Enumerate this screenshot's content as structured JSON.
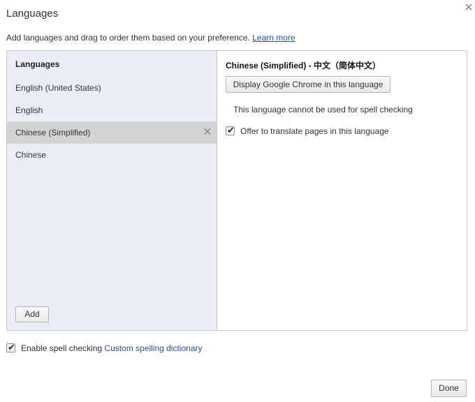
{
  "dialog": {
    "title": "Languages",
    "description": "Add languages and drag to order them based on your preference.",
    "learn_more": "Learn more"
  },
  "left": {
    "header": "Languages",
    "items": [
      {
        "label": "English (United States)",
        "selected": false
      },
      {
        "label": "English",
        "selected": false
      },
      {
        "label": "Chinese (Simplified)",
        "selected": true
      },
      {
        "label": "Chinese",
        "selected": false
      }
    ],
    "add_label": "Add"
  },
  "right": {
    "title": "Chinese (Simplified) - 中文（简体中文）",
    "display_button": "Display Google Chrome in this language",
    "spell_note": "This language cannot be used for spell checking",
    "translate_label": "Offer to translate pages in this language",
    "translate_checked": true
  },
  "footer": {
    "spell_label": "Enable spell checking",
    "spell_checked": true,
    "custom_dictionary": "Custom spelling dictionary",
    "done_label": "Done"
  },
  "colors": {
    "left_bg": "#ebeef9",
    "selected_bg": "#d4d4d4",
    "link": "#1c4fb6"
  },
  "icons": {
    "close": "close-icon",
    "remove": "remove-icon",
    "check": "checkmark-icon"
  }
}
